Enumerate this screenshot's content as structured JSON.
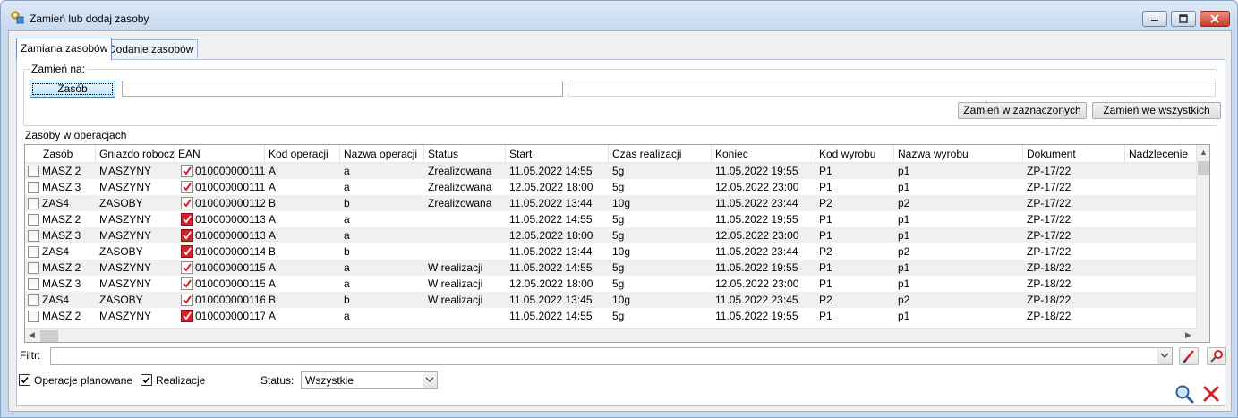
{
  "window": {
    "title": "Zamień lub dodaj zasoby"
  },
  "tabs": [
    {
      "label": "Zamiana zasobów",
      "active": true
    },
    {
      "label": "Dodanie zasobów",
      "active": false
    }
  ],
  "replace_group": {
    "legend": "Zamień na:",
    "resource_button": "Zasób",
    "resource_code_value": "",
    "resource_name_value": "",
    "replace_selected_button": "Zamień w zaznaczonych",
    "replace_all_button": "Zamień we wszystkich"
  },
  "operations_group": {
    "legend": "Zasoby w operacjach",
    "columns": [
      "Zasób",
      "Gniazdo robocze",
      "EAN",
      "Kod operacji",
      "Nazwa operacji",
      "Status",
      "Start",
      "Czas realizacji",
      "Koniec",
      "Kod wyrobu",
      "Nazwa wyrobu",
      "Dokument",
      "Nadzlecenie"
    ],
    "rows": [
      {
        "zasob": "MASZ 2",
        "gniazdo": "MASZYNY",
        "ean": "010000000111",
        "kod": "A",
        "nazwa": "a",
        "status": "Zrealizowana",
        "start": "11.05.2022 14:55",
        "czas": "5g",
        "koniec": "11.05.2022 19:55",
        "kod_wyrobu": "P1",
        "nazwa_wyrobu": "p1",
        "dokument": "ZP-17/22",
        "nadzlecenie": ""
      },
      {
        "zasob": "MASZ 3",
        "gniazdo": "MASZYNY",
        "ean": "010000000111",
        "kod": "A",
        "nazwa": "a",
        "status": "Zrealizowana",
        "start": "12.05.2022 18:00",
        "czas": "5g",
        "koniec": "12.05.2022 23:00",
        "kod_wyrobu": "P1",
        "nazwa_wyrobu": "p1",
        "dokument": "ZP-17/22",
        "nadzlecenie": ""
      },
      {
        "zasob": "ZAS4",
        "gniazdo": "ZASOBY",
        "ean": "010000000112",
        "kod": "B",
        "nazwa": "b",
        "status": "Zrealizowana",
        "start": "11.05.2022 13:44",
        "czas": "10g",
        "koniec": "11.05.2022 23:44",
        "kod_wyrobu": "P2",
        "nazwa_wyrobu": "p2",
        "dokument": "ZP-17/22",
        "nadzlecenie": ""
      },
      {
        "zasob": "MASZ 2",
        "gniazdo": "MASZYNY",
        "ean": "010000000113",
        "kod": "A",
        "nazwa": "a",
        "status": "",
        "start": "11.05.2022 14:55",
        "czas": "5g",
        "koniec": "11.05.2022 19:55",
        "kod_wyrobu": "P1",
        "nazwa_wyrobu": "p1",
        "dokument": "ZP-17/22",
        "nadzlecenie": ""
      },
      {
        "zasob": "MASZ 3",
        "gniazdo": "MASZYNY",
        "ean": "010000000113",
        "kod": "A",
        "nazwa": "a",
        "status": "",
        "start": "12.05.2022 18:00",
        "czas": "5g",
        "koniec": "12.05.2022 23:00",
        "kod_wyrobu": "P1",
        "nazwa_wyrobu": "p1",
        "dokument": "ZP-17/22",
        "nadzlecenie": ""
      },
      {
        "zasob": "ZAS4",
        "gniazdo": "ZASOBY",
        "ean": "010000000114",
        "kod": "B",
        "nazwa": "b",
        "status": "",
        "start": "11.05.2022 13:44",
        "czas": "10g",
        "koniec": "11.05.2022 23:44",
        "kod_wyrobu": "P2",
        "nazwa_wyrobu": "p2",
        "dokument": "ZP-17/22",
        "nadzlecenie": ""
      },
      {
        "zasob": "MASZ 2",
        "gniazdo": "MASZYNY",
        "ean": "010000000115",
        "kod": "A",
        "nazwa": "a",
        "status": "W realizacji",
        "start": "11.05.2022 14:55",
        "czas": "5g",
        "koniec": "11.05.2022 19:55",
        "kod_wyrobu": "P1",
        "nazwa_wyrobu": "p1",
        "dokument": "ZP-18/22",
        "nadzlecenie": ""
      },
      {
        "zasob": "MASZ 3",
        "gniazdo": "MASZYNY",
        "ean": "010000000115",
        "kod": "A",
        "nazwa": "a",
        "status": "W realizacji",
        "start": "12.05.2022 18:00",
        "czas": "5g",
        "koniec": "12.05.2022 23:00",
        "kod_wyrobu": "P1",
        "nazwa_wyrobu": "p1",
        "dokument": "ZP-18/22",
        "nadzlecenie": ""
      },
      {
        "zasob": "ZAS4",
        "gniazdo": "ZASOBY",
        "ean": "010000000116",
        "kod": "B",
        "nazwa": "b",
        "status": "W realizacji",
        "start": "11.05.2022 13:45",
        "czas": "10g",
        "koniec": "11.05.2022 23:45",
        "kod_wyrobu": "P2",
        "nazwa_wyrobu": "p2",
        "dokument": "ZP-18/22",
        "nadzlecenie": ""
      },
      {
        "zasob": "MASZ 2",
        "gniazdo": "MASZYNY",
        "ean": "010000000117",
        "kod": "A",
        "nazwa": "a",
        "status": "",
        "start": "11.05.2022 14:55",
        "czas": "5g",
        "koniec": "11.05.2022 19:55",
        "kod_wyrobu": "P1",
        "nazwa_wyrobu": "p1",
        "dokument": "ZP-18/22",
        "nadzlecenie": ""
      }
    ]
  },
  "filter": {
    "label": "Filtr:",
    "value": ""
  },
  "options": {
    "planned_ops_label": "Operacje planowane",
    "planned_ops_checked": true,
    "realizations_label": "Realizacje",
    "realizations_checked": true,
    "status_label": "Status:",
    "status_value": "Wszystkie"
  },
  "icons": {
    "app": "app-icon",
    "ean_checked": "ean-checked-icon",
    "clear_filter": "clear-filter-icon",
    "build_filter": "build-filter-icon",
    "search": "search-icon",
    "cancel": "cancel-icon"
  },
  "colors": {
    "title_gradient": "#c9dbef",
    "close_button": "#c43c25",
    "row_alt": "#f0f0f0",
    "ean_icon": "#d6202c"
  }
}
